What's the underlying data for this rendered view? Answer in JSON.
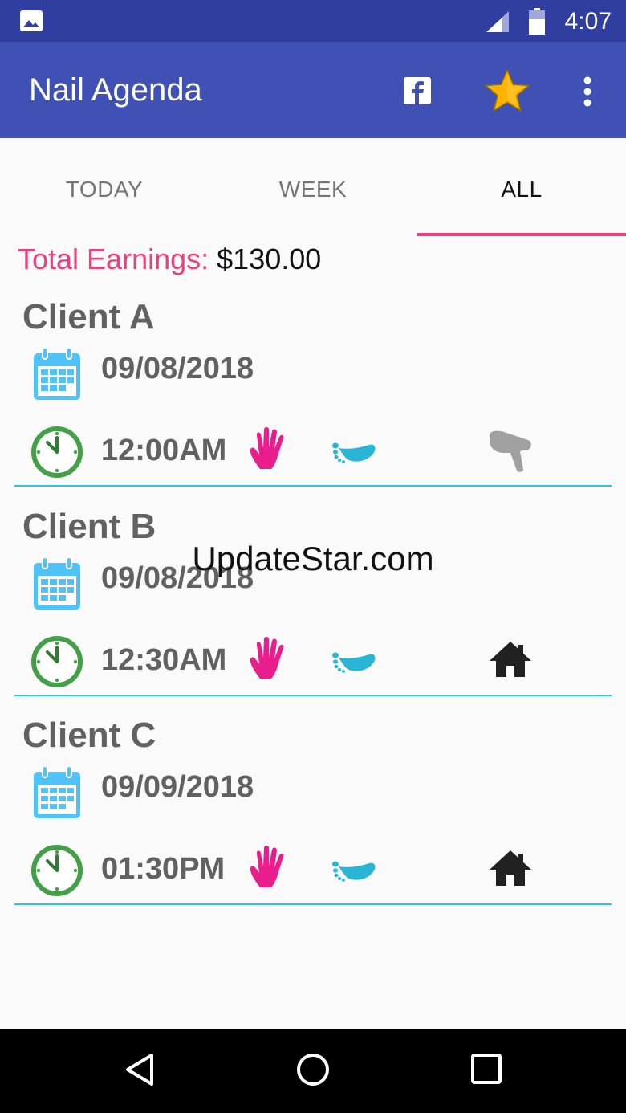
{
  "status_bar": {
    "time": "4:07",
    "icons": [
      "image-icon",
      "signal-icon",
      "battery-icon"
    ]
  },
  "app_bar": {
    "title": "Nail Agenda",
    "actions": [
      "facebook-icon",
      "star-icon",
      "more-vert-icon"
    ]
  },
  "tabs": [
    {
      "label": "TODAY",
      "active": false
    },
    {
      "label": "WEEK",
      "active": false
    },
    {
      "label": "ALL",
      "active": true
    }
  ],
  "earnings": {
    "label": "Total Earnings:",
    "value": "$130.00"
  },
  "clients": [
    {
      "name": "Client A",
      "date": "09/08/2018",
      "time": "12:00AM",
      "services": [
        "hand-icon",
        "foot-icon",
        "hair-dryer-icon"
      ]
    },
    {
      "name": "Client B",
      "date": "09/08/2018",
      "time": "12:30AM",
      "services": [
        "hand-icon",
        "foot-icon",
        "home-icon"
      ]
    },
    {
      "name": "Client C",
      "date": "09/09/2018",
      "time": "01:30PM",
      "services": [
        "hand-icon",
        "foot-icon",
        "home-icon"
      ]
    }
  ],
  "watermark": "UpdateStar.com",
  "colors": {
    "status_bar": "#303f9f",
    "app_bar": "#3f51b5",
    "accent": "#ec407a",
    "divider": "#29c5e6",
    "calendar": "#4fc3f7",
    "clock": "#43a047",
    "hand": "#e91e8c",
    "foot": "#29b6d6"
  },
  "nav_bar": {
    "buttons": [
      "back-icon",
      "home-nav-icon",
      "recents-icon"
    ]
  }
}
